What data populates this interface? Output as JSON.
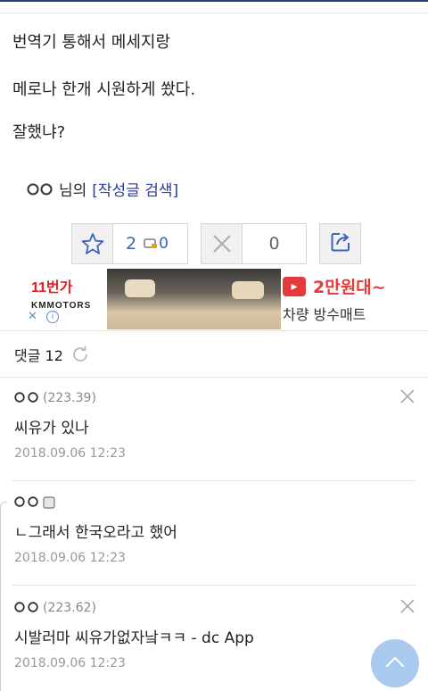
{
  "post": {
    "lines": [
      "번역기 통해서 메세지랑",
      "메로나 한개 시원하게 쐈다.",
      "잘했냐?"
    ],
    "writer_suffix": "님의",
    "writer_search": "[작성글 검색]"
  },
  "actions": {
    "recommend_count": "2",
    "mobile_recommend_count": "0",
    "nonrecommend_count": "0"
  },
  "ad": {
    "brand": "11번가",
    "sub": "KMMOTORS",
    "tag": "2만원대~",
    "title": "차량 방수매트",
    "close": "✕",
    "info": "i"
  },
  "comments_header": {
    "label": "댓글 12"
  },
  "comments": [
    {
      "ip": "(223.39)",
      "body": "씨유가 있나",
      "date": "2018.09.06 12:23"
    },
    {
      "ip": "",
      "body": "ㄴ그래서 한국오라고 했어",
      "date": "2018.09.06 12:23"
    },
    {
      "ip": "(223.62)",
      "body": "시발러마 씨유가없자낰ㅋㅋ - dc App",
      "date": "2018.09.06 12:23"
    }
  ],
  "colors": {
    "accent_blue": "#3a64b8",
    "link_blue": "#2a3aa0",
    "ad_red": "#e33b3b"
  },
  "icons": {
    "recommend": "star-icon",
    "mobile": "phone-icon",
    "nonrecommend": "x-icon",
    "share": "share-icon",
    "refresh": "refresh-icon",
    "close": "close-icon",
    "scroll_top": "chevron-up-icon"
  }
}
